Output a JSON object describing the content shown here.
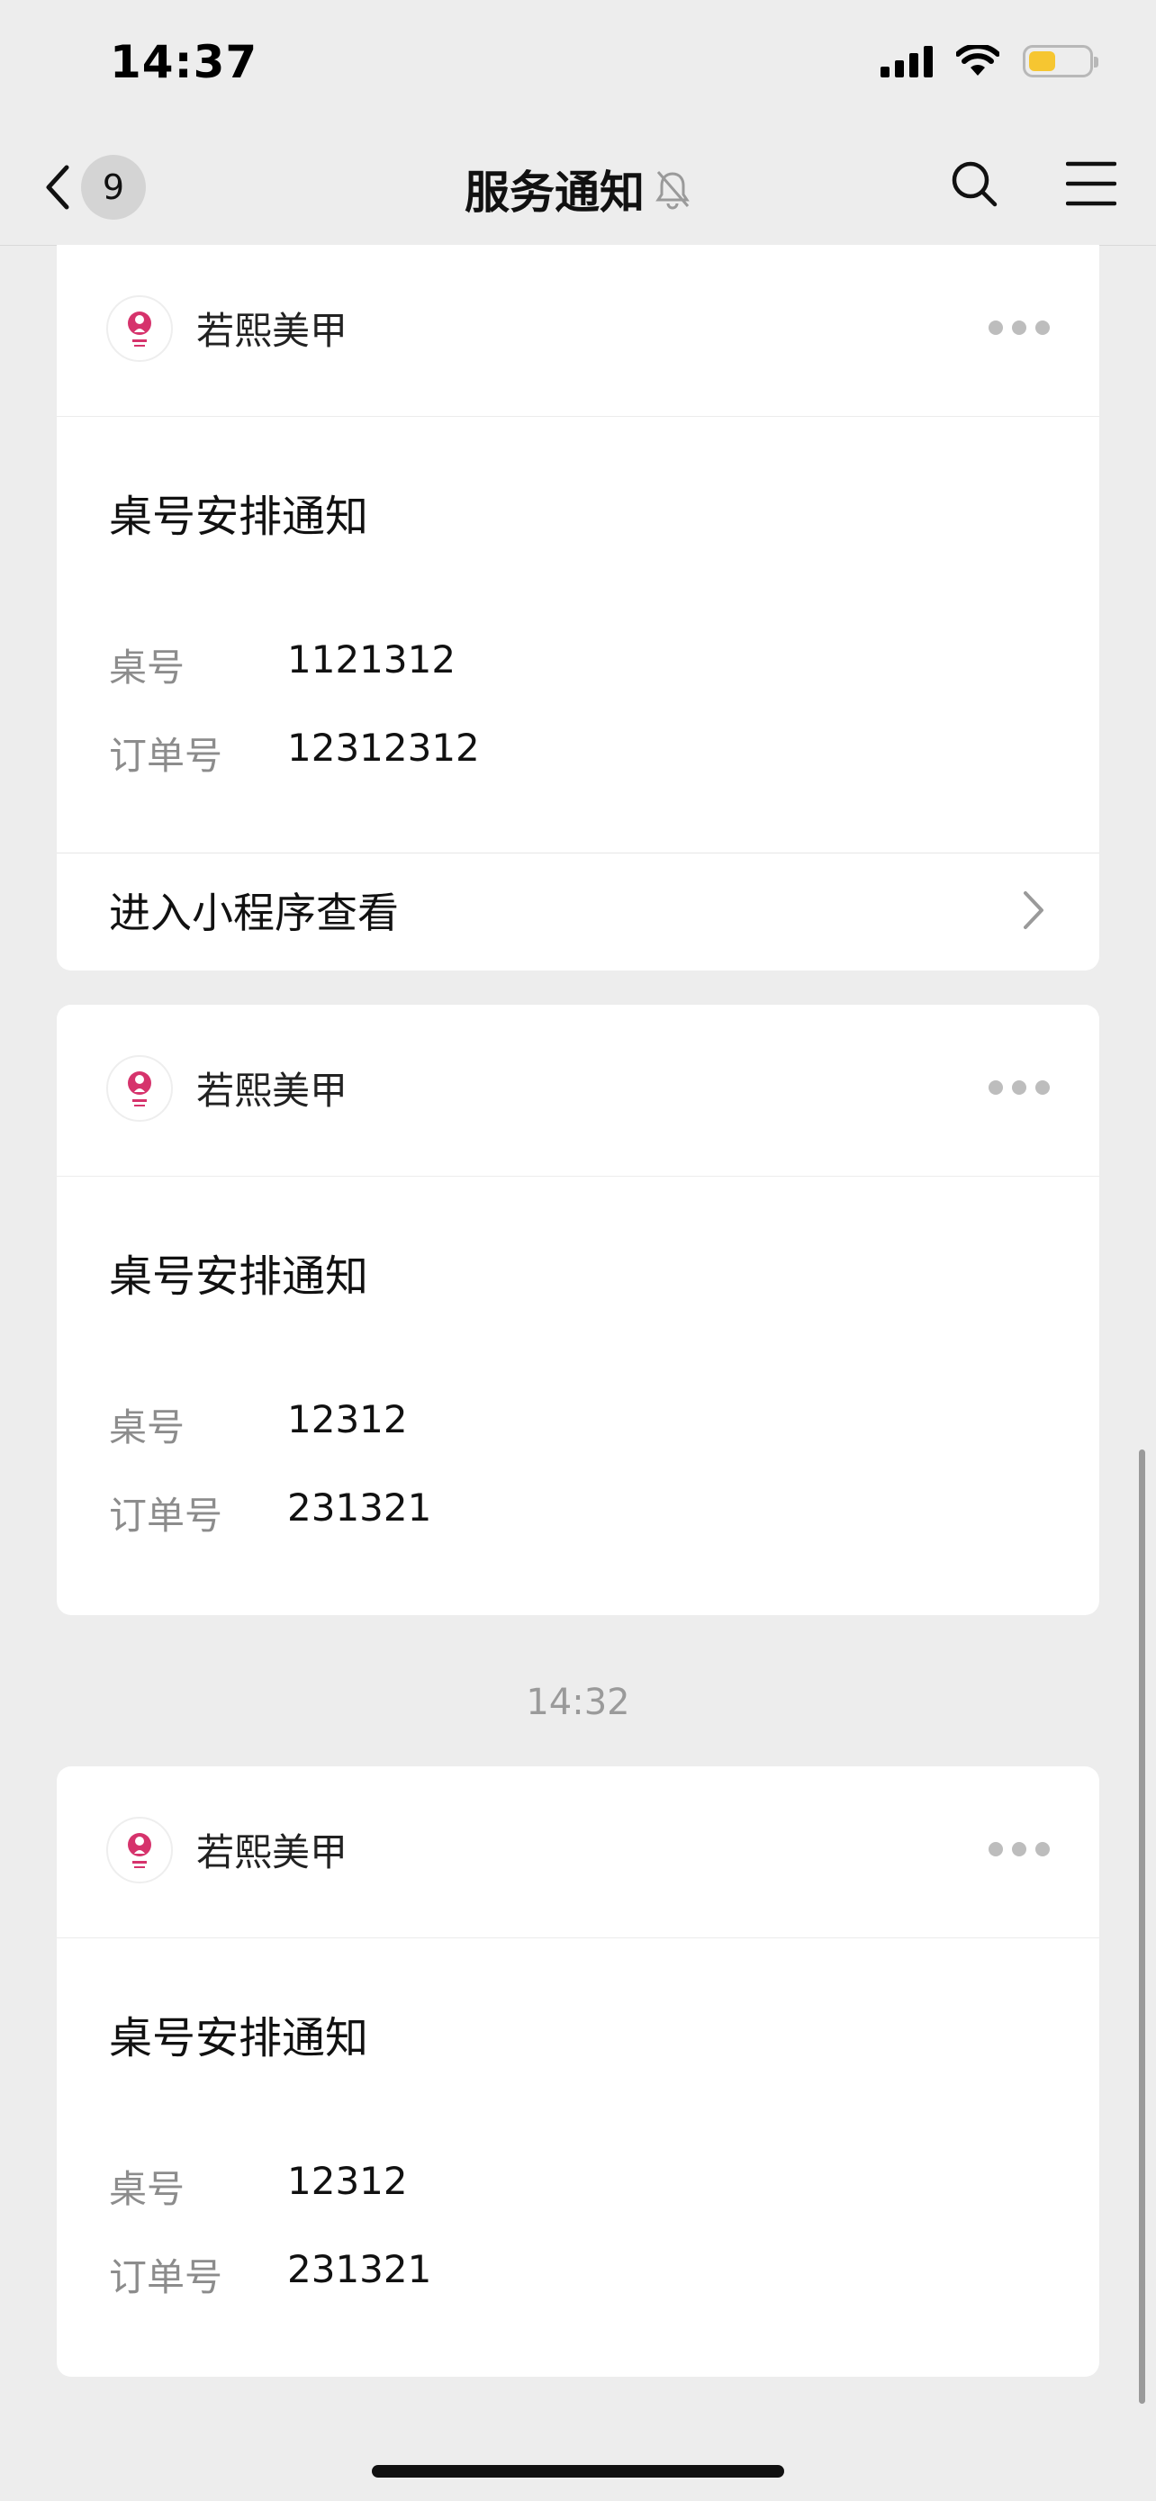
{
  "status_bar": {
    "time": "14:37",
    "battery_level": 0.45,
    "battery_color": "#f6c631"
  },
  "nav": {
    "back_badge": "9",
    "title": "服务通知",
    "icons": [
      "chevron-left-icon",
      "bell-muted-icon",
      "search-icon",
      "menu-icon"
    ]
  },
  "cards": [
    {
      "sender": "若熙美甲",
      "title": "桌号安排通知",
      "fields": [
        {
          "label": "桌号",
          "value": "1121312"
        },
        {
          "label": "订单号",
          "value": "12312312"
        }
      ],
      "footer_link": "进入小程序查看"
    },
    {
      "sender": "若熙美甲",
      "title": "桌号安排通知",
      "fields": [
        {
          "label": "桌号",
          "value": "12312"
        },
        {
          "label": "订单号",
          "value": "231321"
        }
      ]
    },
    {
      "sender": "若熙美甲",
      "title": "桌号安排通知",
      "fields": [
        {
          "label": "桌号",
          "value": "12312"
        },
        {
          "label": "订单号",
          "value": "231321"
        }
      ]
    }
  ],
  "timestamp": "14:32",
  "colors": {
    "background": "#ededed",
    "card": "#ffffff",
    "avatar_accent": "#d6336c",
    "muted_text": "#8c8c8c"
  }
}
